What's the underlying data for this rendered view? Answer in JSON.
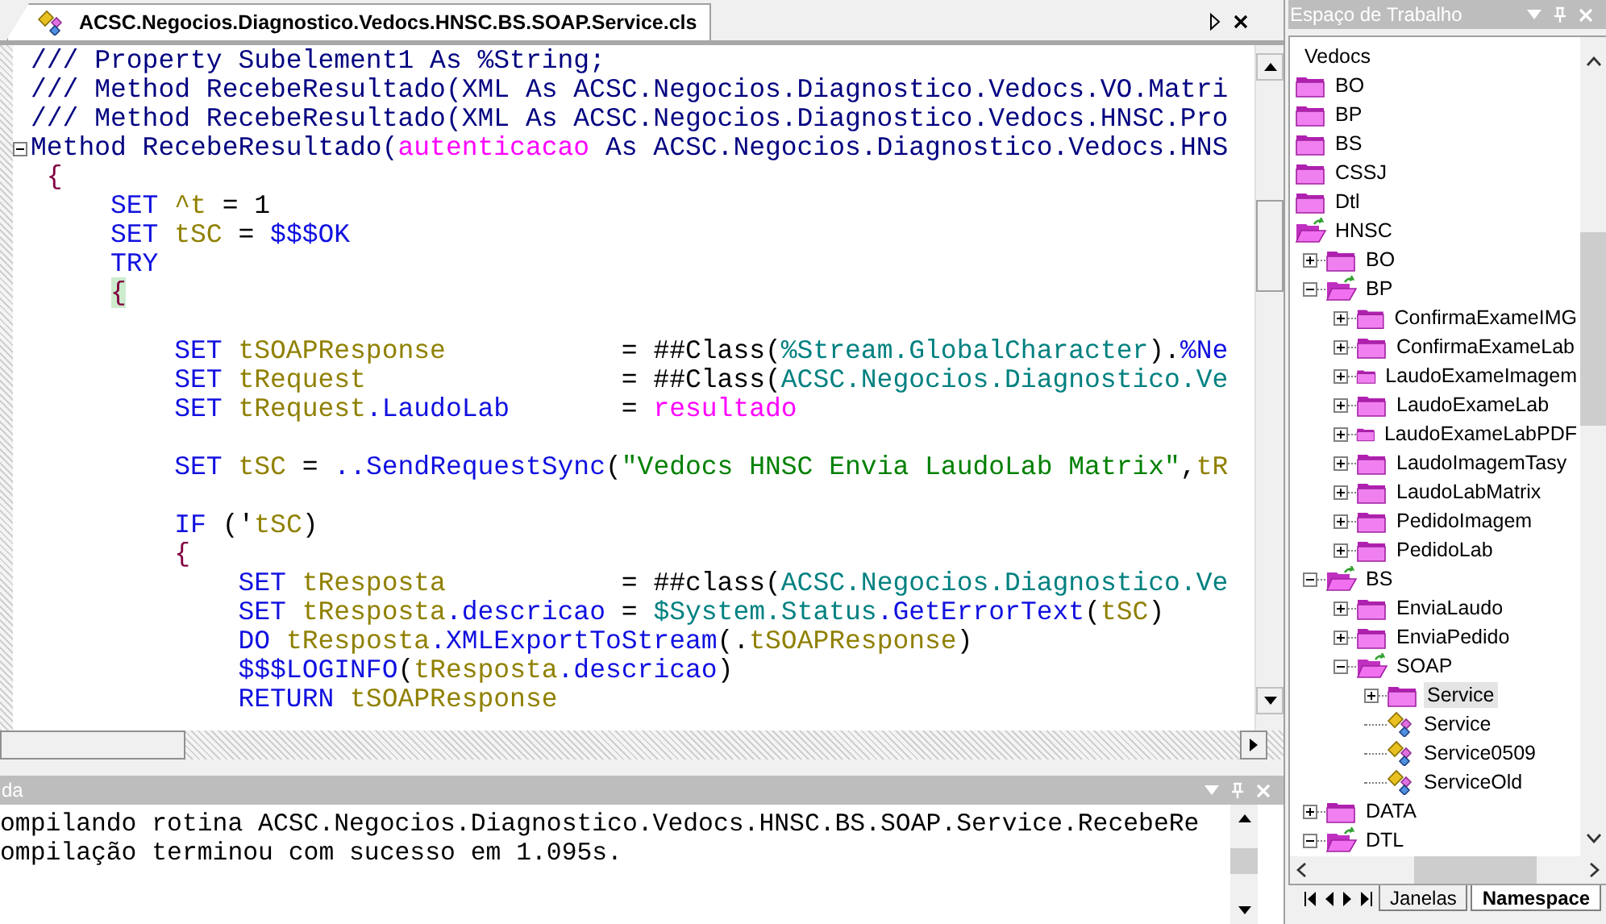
{
  "editor": {
    "tab": {
      "title": "ACSC.Negocios.Diagnostico.Vedocs.HNSC.BS.SOAP.Service.cls"
    },
    "lines": [
      {
        "kind": "code",
        "tokens": [
          {
            "text": "/// Property Subelement1 As %String;",
            "kind": "comment"
          }
        ]
      },
      {
        "kind": "code",
        "tokens": [
          {
            "text": "/// Method RecebeResultado(XML As ACSC.Negocios.Diagnostico.Vedocs.VO.Matri",
            "kind": "comment"
          }
        ]
      },
      {
        "kind": "code",
        "tokens": [
          {
            "text": "/// Method RecebeResultado(XML As ACSC.Negocios.Diagnostico.Vedocs.HNSC.Pro",
            "kind": "comment"
          }
        ]
      },
      {
        "kind": "fold",
        "expanded": true,
        "tokens": [
          {
            "text": "Method RecebeResultado(",
            "kind": "name"
          },
          {
            "text": "autenticacao",
            "kind": "param"
          },
          {
            "text": " As ACSC.Negocios.Diagnostico.Vedocs.HNS",
            "kind": "name"
          }
        ]
      },
      {
        "kind": "method",
        "tokens": [
          {
            "text": "{",
            "kind": "brace"
          }
        ]
      },
      {
        "kind": "body",
        "tokens": [
          {
            "text": "SET ",
            "kind": "keyword"
          },
          {
            "text": "^t",
            "kind": "variable"
          },
          {
            "text": " = 1",
            "kind": "punct"
          }
        ]
      },
      {
        "kind": "body",
        "tokens": [
          {
            "text": "SET ",
            "kind": "keyword"
          },
          {
            "text": "tSC",
            "kind": "variable"
          },
          {
            "text": " = ",
            "kind": "punct"
          },
          {
            "text": "$$$OK",
            "kind": "member"
          }
        ]
      },
      {
        "kind": "body",
        "tokens": [
          {
            "text": "TRY",
            "kind": "keyword"
          }
        ]
      },
      {
        "kind": "body",
        "tokens": [
          {
            "text": "{",
            "kind": "brace-match"
          }
        ]
      },
      {
        "kind": "blank"
      },
      {
        "kind": "try",
        "tokens": [
          {
            "text": "SET ",
            "kind": "keyword"
          },
          {
            "text": "tSOAPResponse",
            "kind": "variable"
          },
          {
            "text": "           = ",
            "kind": "punct"
          },
          {
            "text": "##Class(",
            "kind": "punct"
          },
          {
            "text": "%Stream.GlobalCharacter",
            "kind": "class"
          },
          {
            "text": ").",
            "kind": "punct"
          },
          {
            "text": "%Ne",
            "kind": "member"
          }
        ]
      },
      {
        "kind": "try",
        "tokens": [
          {
            "text": "SET ",
            "kind": "keyword"
          },
          {
            "text": "tRequest",
            "kind": "variable"
          },
          {
            "text": "                = ",
            "kind": "punct"
          },
          {
            "text": "##Class(",
            "kind": "punct"
          },
          {
            "text": "ACSC.Negocios.Diagnostico.Ve",
            "kind": "class"
          }
        ]
      },
      {
        "kind": "try",
        "tokens": [
          {
            "text": "SET ",
            "kind": "keyword"
          },
          {
            "text": "tRequest",
            "kind": "variable"
          },
          {
            "text": ".LaudoLab",
            "kind": "member"
          },
          {
            "text": "       = ",
            "kind": "punct"
          },
          {
            "text": "resultado",
            "kind": "param"
          }
        ]
      },
      {
        "kind": "blank"
      },
      {
        "kind": "try",
        "tokens": [
          {
            "text": "SET ",
            "kind": "keyword"
          },
          {
            "text": "tSC",
            "kind": "variable"
          },
          {
            "text": " = ",
            "kind": "punct"
          },
          {
            "text": "..SendRequestSync",
            "kind": "member"
          },
          {
            "text": "(",
            "kind": "punct"
          },
          {
            "text": "\"Vedocs HNSC Envia LaudoLab Matrix\"",
            "kind": "string"
          },
          {
            "text": ",",
            "kind": "punct"
          },
          {
            "text": "tR",
            "kind": "variable"
          }
        ]
      },
      {
        "kind": "blank"
      },
      {
        "kind": "try",
        "tokens": [
          {
            "text": "IF ",
            "kind": "keyword"
          },
          {
            "text": "('",
            "kind": "punct"
          },
          {
            "text": "tSC",
            "kind": "variable"
          },
          {
            "text": ")",
            "kind": "punct"
          }
        ]
      },
      {
        "kind": "try",
        "tokens": [
          {
            "text": "{",
            "kind": "brace"
          }
        ]
      },
      {
        "kind": "if",
        "tokens": [
          {
            "text": "SET ",
            "kind": "keyword"
          },
          {
            "text": "tResposta",
            "kind": "variable"
          },
          {
            "text": "           = ",
            "kind": "punct"
          },
          {
            "text": "##class(",
            "kind": "punct"
          },
          {
            "text": "ACSC.Negocios.Diagnostico.Ve",
            "kind": "class"
          }
        ]
      },
      {
        "kind": "if",
        "tokens": [
          {
            "text": "SET ",
            "kind": "keyword"
          },
          {
            "text": "tResposta",
            "kind": "variable"
          },
          {
            "text": ".descricao",
            "kind": "member"
          },
          {
            "text": " = ",
            "kind": "punct"
          },
          {
            "text": "$System.Status",
            "kind": "class"
          },
          {
            "text": ".GetErrorText",
            "kind": "member"
          },
          {
            "text": "(",
            "kind": "punct"
          },
          {
            "text": "tSC",
            "kind": "variable"
          },
          {
            "text": ")",
            "kind": "punct"
          }
        ]
      },
      {
        "kind": "if",
        "tokens": [
          {
            "text": "DO ",
            "kind": "keyword"
          },
          {
            "text": "tResposta",
            "kind": "variable"
          },
          {
            "text": ".XMLExportToStream",
            "kind": "member"
          },
          {
            "text": "(.",
            "kind": "punct"
          },
          {
            "text": "tSOAPResponse",
            "kind": "variable"
          },
          {
            "text": ")",
            "kind": "punct"
          }
        ]
      },
      {
        "kind": "if",
        "tokens": [
          {
            "text": "$$$LOGINFO",
            "kind": "member"
          },
          {
            "text": "(",
            "kind": "punct"
          },
          {
            "text": "tResposta",
            "kind": "variable"
          },
          {
            "text": ".descricao",
            "kind": "member"
          },
          {
            "text": ")",
            "kind": "punct"
          }
        ]
      },
      {
        "kind": "if",
        "tokens": [
          {
            "text": "RETURN ",
            "kind": "keyword"
          },
          {
            "text": "tSOAPResponse",
            "kind": "variable"
          }
        ]
      }
    ]
  },
  "output": {
    "title": "da",
    "lines": [
      "ompilando rotina ACSC.Negocios.Diagnostico.Vedocs.HNSC.BS.SOAP.Service.RecebeRe",
      "ompilação terminou com sucesso em 1.095s."
    ]
  },
  "workspace": {
    "title": "Espaço de Trabalho",
    "tree": {
      "label": "Vedocs",
      "selected": false,
      "children": [
        {
          "label": "BO",
          "kind": "folder",
          "expanded": false,
          "selected": false
        },
        {
          "label": "BP",
          "kind": "folder",
          "expanded": false,
          "selected": false
        },
        {
          "label": "BS",
          "kind": "folder",
          "expanded": false,
          "selected": false
        },
        {
          "label": "CSSJ",
          "kind": "folder",
          "expanded": false,
          "selected": false
        },
        {
          "label": "Dtl",
          "kind": "folder",
          "expanded": false,
          "selected": false
        },
        {
          "label": "HNSC",
          "kind": "folder",
          "expanded": true,
          "selected": false,
          "children": [
            {
              "label": "BO",
              "kind": "folder",
              "expanded": false,
              "selected": false
            },
            {
              "label": "BP",
              "kind": "folder",
              "expanded": true,
              "selected": false,
              "children": [
                {
                  "label": "ConfirmaExameIMG",
                  "kind": "folder",
                  "expanded": false,
                  "selected": false
                },
                {
                  "label": "ConfirmaExameLab",
                  "kind": "folder",
                  "expanded": false,
                  "selected": false
                },
                {
                  "label": "LaudoExameImagem",
                  "kind": "folder",
                  "expanded": false,
                  "selected": false
                },
                {
                  "label": "LaudoExameLab",
                  "kind": "folder",
                  "expanded": false,
                  "selected": false
                },
                {
                  "label": "LaudoExameLabPDF",
                  "kind": "folder",
                  "expanded": false,
                  "selected": false
                },
                {
                  "label": "LaudoImagemTasy",
                  "kind": "folder",
                  "expanded": false,
                  "selected": false
                },
                {
                  "label": "LaudoLabMatrix",
                  "kind": "folder",
                  "expanded": false,
                  "selected": false
                },
                {
                  "label": "PedidoImagem",
                  "kind": "folder",
                  "expanded": false,
                  "selected": false
                },
                {
                  "label": "PedidoLab",
                  "kind": "folder",
                  "expanded": false,
                  "selected": false
                }
              ]
            },
            {
              "label": "BS",
              "kind": "folder",
              "expanded": true,
              "selected": false,
              "children": [
                {
                  "label": "EnviaLaudo",
                  "kind": "folder",
                  "expanded": false,
                  "selected": false
                },
                {
                  "label": "EnviaPedido",
                  "kind": "folder",
                  "expanded": false,
                  "selected": false
                },
                {
                  "label": "SOAP",
                  "kind": "folder",
                  "expanded": true,
                  "selected": false,
                  "children": [
                    {
                      "label": "Service",
                      "kind": "folder",
                      "expanded": false,
                      "selected": true
                    },
                    {
                      "label": "Service",
                      "kind": "class",
                      "selected": false
                    },
                    {
                      "label": "Service0509",
                      "kind": "class",
                      "selected": false
                    },
                    {
                      "label": "ServiceOld",
                      "kind": "class",
                      "selected": false
                    }
                  ]
                }
              ]
            },
            {
              "label": "DATA",
              "kind": "folder",
              "expanded": false,
              "selected": false
            },
            {
              "label": "DTL",
              "kind": "folder",
              "expanded": true,
              "selected": false
            }
          ]
        }
      ]
    },
    "tabs": [
      {
        "label": "Janelas",
        "selected": false
      },
      {
        "label": "Namespace",
        "selected": true
      }
    ]
  }
}
